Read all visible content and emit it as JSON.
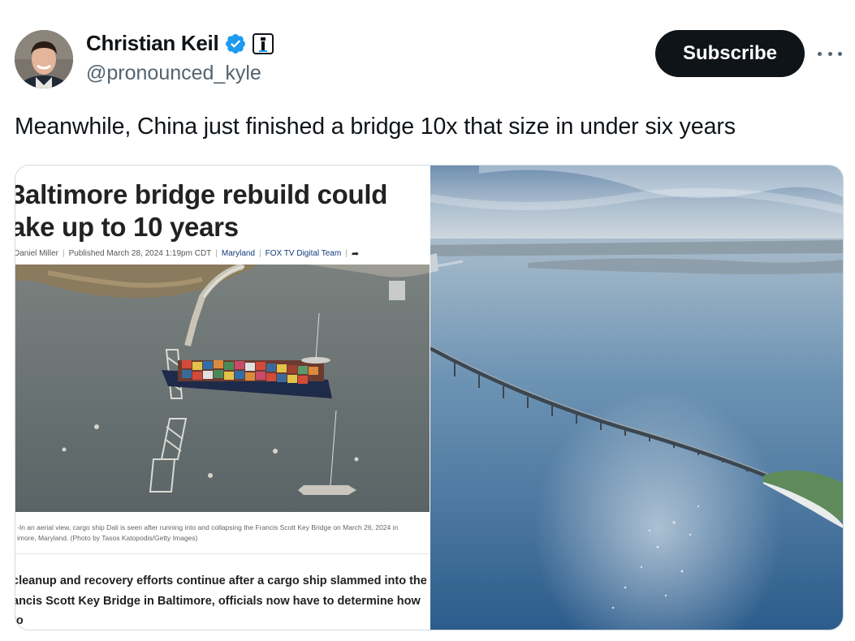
{
  "author": {
    "display_name": "Christian Keil",
    "handle": "@pronounced_kyle"
  },
  "actions": {
    "subscribe_label": "Subscribe"
  },
  "icons": {
    "verified": "verified-badge-icon",
    "affiliation": "affiliation-badge-icon",
    "more": "more-options-icon"
  },
  "tweet": {
    "text": "Meanwhile, China just finished a bridge 10x that size in under six years"
  },
  "article_screenshot": {
    "headline": "3altimore bridge rebuild could\nake up to 10 years",
    "byline": "Daniel Miller",
    "published": "Published  March 28, 2024 1:19pm CDT",
    "section": "Maryland",
    "source": "FOX TV Digital Team",
    "caption": "-In an aerial view, cargo ship Dali is seen after running into and collapsing the Francis Scott Key Bridge on March 26, 2024 in\nimore, Maryland. (Photo by Tasos Katopodis/Getty Images)",
    "body": " cleanup and recovery efforts continue after a cargo ship slammed into the\nancis Scott Key Bridge in Baltimore, officials now have to determine how to\nuild the bridge and the length of time it will take."
  },
  "colors": {
    "text_primary": "#0f1419",
    "text_secondary": "#536471",
    "verified_blue": "#1d9bf0",
    "button_dark": "#0f1419"
  }
}
